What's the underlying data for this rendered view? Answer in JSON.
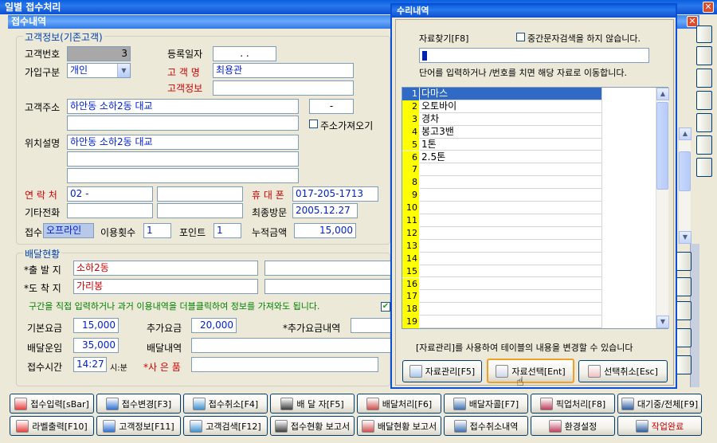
{
  "main_window": {
    "title": "일별 접수처리",
    "subtitle": "접수내역"
  },
  "customer": {
    "legend": "고객정보(기존고객)",
    "id_label": "고객번호",
    "id_value": "3",
    "reg_date_label": "등록일자",
    "reg_date_value": ".   .",
    "join_type_label": "가입구분",
    "join_type_value": "개인",
    "name_label": "고 객 명",
    "name_value": "최용관",
    "info_label": "고객정보",
    "address_label": "고객주소",
    "address_value": "하안동 소하2동 대교",
    "zip_value": "-",
    "address_fetch_label": "주소가져오기",
    "location_label": "위치설명",
    "location_value": "하안동 소하2동 대교",
    "contact_label": "연 락 처",
    "contact_value": "02   -",
    "mobile_label": "휴 대 폰",
    "mobile_value": "017-205-1713",
    "other_phone_label": "기타전화",
    "last_visit_label": "최종방문",
    "last_visit_value": "2005.12.27",
    "receipt_label": "접수",
    "receipt_value": "오프라인",
    "use_count_label": "이용횟수",
    "use_count_value": "1",
    "points_label": "포인트",
    "points_value": "1",
    "cumulative_label": "누적금액",
    "cumulative_value": "15,000"
  },
  "delivery": {
    "legend": "배달현황",
    "origin_label": "*출 발 지",
    "origin_value": "소하2동",
    "dest_label": "*도 착 지",
    "dest_value": "가리봉",
    "hint": "구간을 직접 입력하거나 과거 이용내역을 더블클릭하여 정보를 가져와도 됩니다.",
    "base_fee_label": "기본요금",
    "base_fee_value": "15,000",
    "extra_fee_label": "추가요금",
    "extra_fee_value": "20,000",
    "extra_detail_label": "*추가요금내역",
    "delivery_fare_label": "배달운임",
    "delivery_fare_value": "35,000",
    "delivery_detail_label": "배달내역",
    "time_label": "접수시간",
    "time_value": "14:27",
    "time_unit": "시:분",
    "gift_label": "*사 은 품"
  },
  "popup": {
    "title": "수리내역",
    "search_label": "자료찾기[F8]",
    "middle_search_label": "중간문자검색을 하지 않습니다.",
    "hint": "단어를 입력하거나   /번호를 치면 해당 자료로 이동합니다.",
    "footer_hint": "[자료관리]를 사용하여 테이블의 내용을 변경할 수 있습니다",
    "rows": [
      {
        "num": "1",
        "text": "다마스"
      },
      {
        "num": "2",
        "text": "오토바이"
      },
      {
        "num": "3",
        "text": "경차"
      },
      {
        "num": "4",
        "text": "봉고3밴"
      },
      {
        "num": "5",
        "text": "1톤"
      },
      {
        "num": "6",
        "text": "2.5톤"
      },
      {
        "num": "7",
        "text": ""
      },
      {
        "num": "8",
        "text": ""
      },
      {
        "num": "9",
        "text": ""
      },
      {
        "num": "10",
        "text": ""
      },
      {
        "num": "11",
        "text": ""
      },
      {
        "num": "12",
        "text": ""
      },
      {
        "num": "13",
        "text": ""
      },
      {
        "num": "14",
        "text": ""
      },
      {
        "num": "15",
        "text": ""
      },
      {
        "num": "16",
        "text": ""
      },
      {
        "num": "17",
        "text": ""
      },
      {
        "num": "18",
        "text": ""
      },
      {
        "num": "19",
        "text": ""
      }
    ],
    "btn_manage": "자료관리[F5]",
    "btn_select": "자료선택[Ent]",
    "btn_cancel": "선택취소[Esc]"
  },
  "toolbar": {
    "row1": [
      "접수입력[sBar]",
      "접수변경[F3]",
      "접수취소[F4]",
      "배 달 자[F5]",
      "배달처리[F6]",
      "배달자콜[F7]",
      "픽업처리[F8]",
      "대기중/전체[F9]"
    ],
    "row2": [
      "라벨출력[F10]",
      "고객정보[F11]",
      "고객검색[F12]",
      "접수현황 보고서",
      "배달현황 보고서",
      "접수취소내역",
      "환경설정",
      "작업완료"
    ]
  },
  "colors": {
    "titlebar": "#0a5fe0",
    "selected_row": "#316ac5",
    "row_number_bg": "#ffff00",
    "label_red": "#d00000",
    "field_text_blue": "#0020d0"
  }
}
